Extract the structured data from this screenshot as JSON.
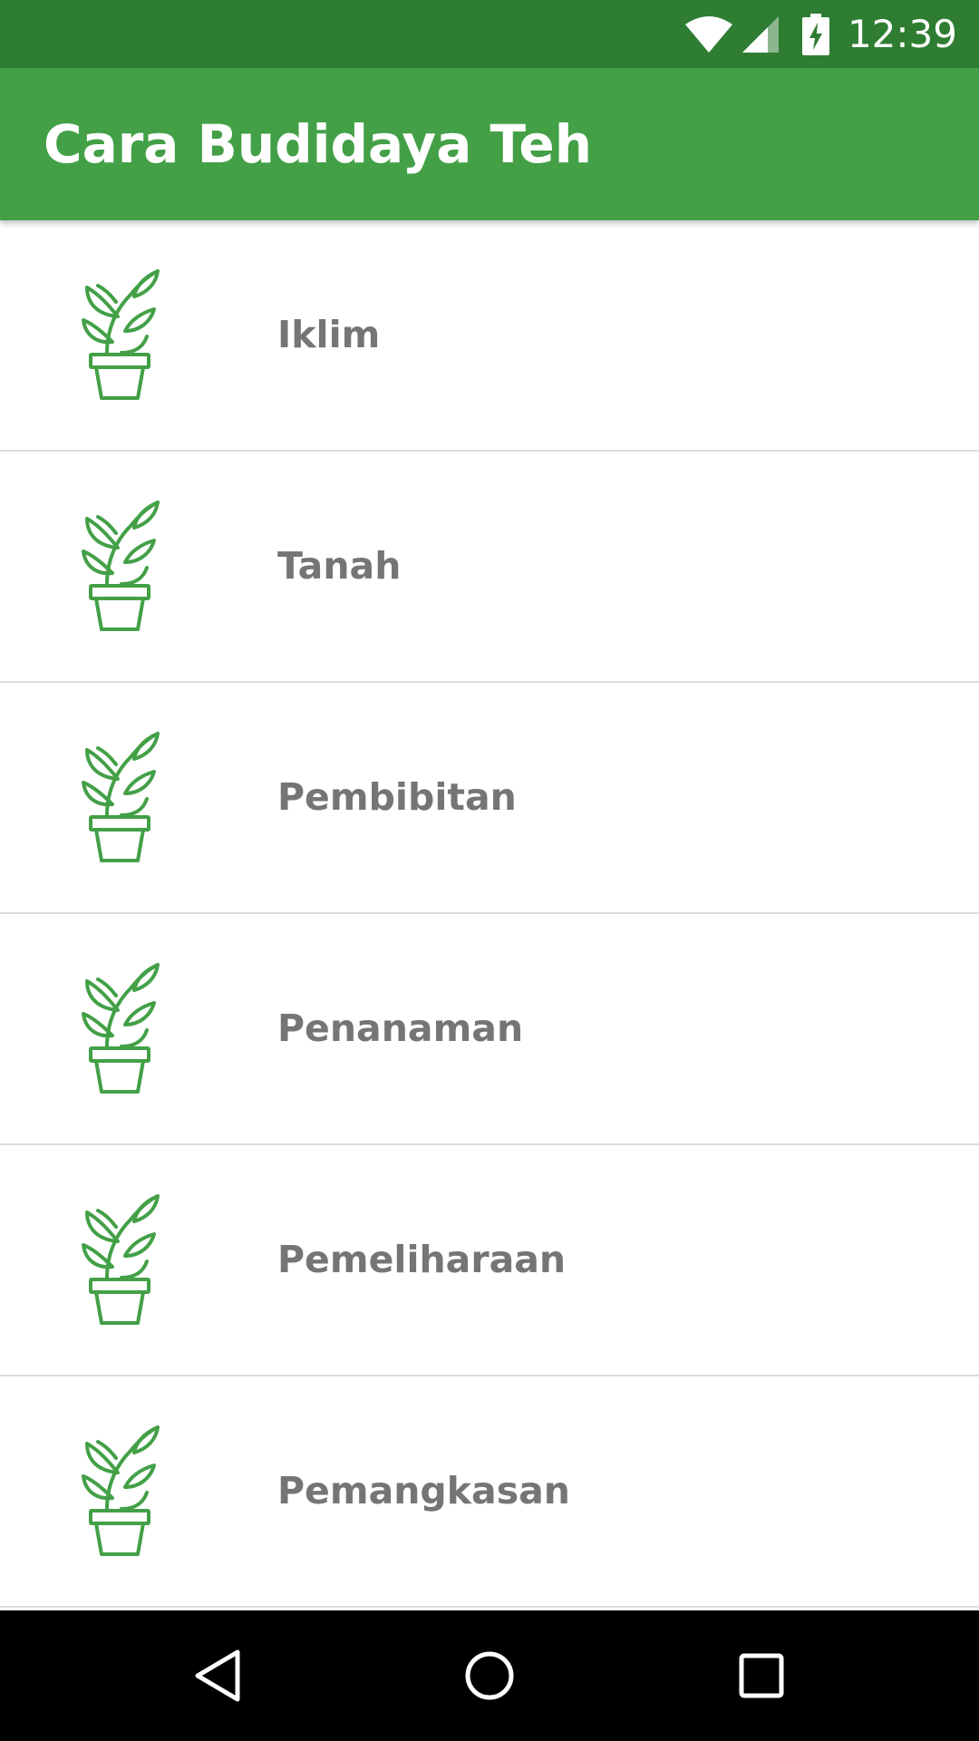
{
  "status_bar": {
    "time": "12:39",
    "icons": [
      "wifi-icon",
      "cell-signal-icon",
      "battery-charging-icon"
    ],
    "background": "#2e7d32"
  },
  "app_bar": {
    "title": "Cara Budidaya Teh",
    "background": "#43a047"
  },
  "list": {
    "item_icon": "potted-plant-icon",
    "icon_color": "#43a047",
    "label_color": "#757575",
    "items": [
      {
        "label": "Iklim"
      },
      {
        "label": "Tanah"
      },
      {
        "label": "Pembibitan"
      },
      {
        "label": "Penanaman"
      },
      {
        "label": "Pemeliharaan"
      },
      {
        "label": "Pemangkasan"
      }
    ]
  },
  "nav_bar": {
    "buttons": [
      "back-icon",
      "home-icon",
      "recents-icon"
    ]
  }
}
